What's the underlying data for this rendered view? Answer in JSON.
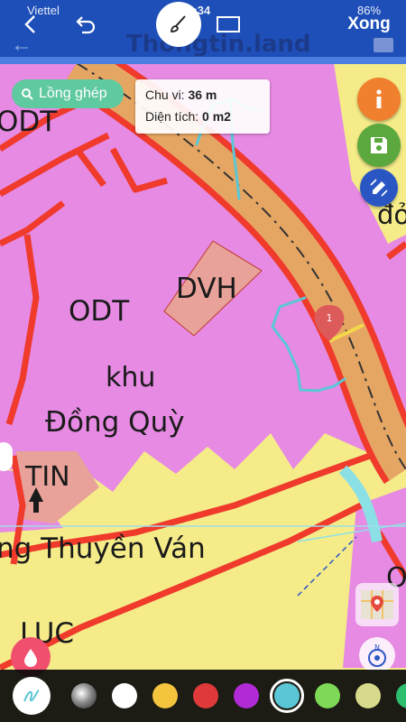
{
  "status_bar": {
    "carrier": "Viettel",
    "time": "14:34",
    "battery": "86%"
  },
  "app": {
    "title": "Thongtin.land"
  },
  "edit_bar": {
    "done_label": "Xong"
  },
  "layer_button": {
    "label": "Lồng ghép"
  },
  "measure": {
    "perimeter_label": "Chu vi:",
    "perimeter_value": "36 m",
    "area_label": "Diện tích:",
    "area_value": "0 m2"
  },
  "map": {
    "zones": [
      "ODT",
      "ODT",
      "DVH",
      "TIN",
      "LUC",
      "O"
    ],
    "texts": [
      "khu",
      "Đồng Quỳ",
      "ng Thuyền Ván",
      "đở"
    ],
    "marker_number": "1"
  },
  "icons": {
    "back": "back-chevron-icon",
    "undo": "undo-icon",
    "brush": "brush-icon",
    "rect": "rectangle-icon",
    "info": "info-icon",
    "save": "save-icon",
    "draw": "draw-area-icon",
    "layers": "search-icon",
    "map_thumb": "map-thumbnail-icon",
    "compass": "compass-icon",
    "drop": "drop-icon"
  },
  "colors": {
    "land_odt": "#e68ae3",
    "land_yellow": "#f5ec89",
    "road_fill": "#e6a663",
    "boundary_red": "#ef3a2c",
    "dvh_fill": "#e8a29a",
    "annotation_cyan": "#5bc6d6",
    "accent_green": "#5fc9a0"
  },
  "palette": {
    "colors": [
      "#8a8a8a",
      "#ffffff",
      "#f4c43e",
      "#e0393a",
      "#b02ad6",
      "#5bc6d6",
      "#7ed957",
      "#d9d98c",
      "#2dbf6e"
    ],
    "selected": "#5bc6d6"
  }
}
